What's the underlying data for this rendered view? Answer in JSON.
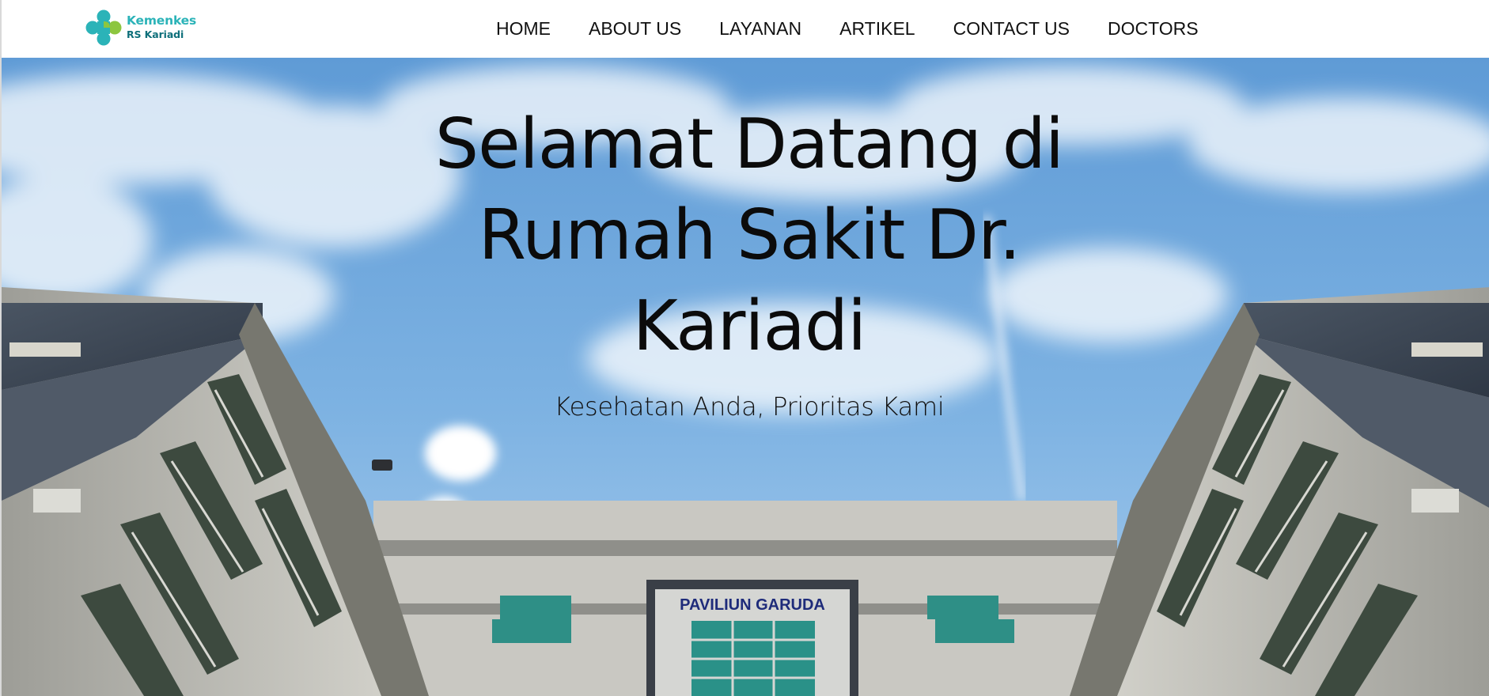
{
  "brand": {
    "line1": "Kemenkes",
    "line2": "RS Kariadi",
    "logo_icon": "kemenkes-cross-logo",
    "colors": {
      "teal": "#2bb3b8",
      "green": "#8cc63f",
      "dark_teal": "#0e6f7a"
    }
  },
  "nav": {
    "items": [
      {
        "label": "HOME"
      },
      {
        "label": "ABOUT US"
      },
      {
        "label": "LAYANAN"
      },
      {
        "label": "ARTIKEL"
      },
      {
        "label": "CONTACT US"
      },
      {
        "label": "DOCTORS"
      }
    ]
  },
  "hero": {
    "title_lines": [
      "Selamat Datang di",
      "Rumah Sakit Dr.",
      "Kariadi"
    ],
    "subtitle": "Kesehatan Anda, Prioritas Kami",
    "building_sign": "PAVILIUN GARUDA"
  }
}
